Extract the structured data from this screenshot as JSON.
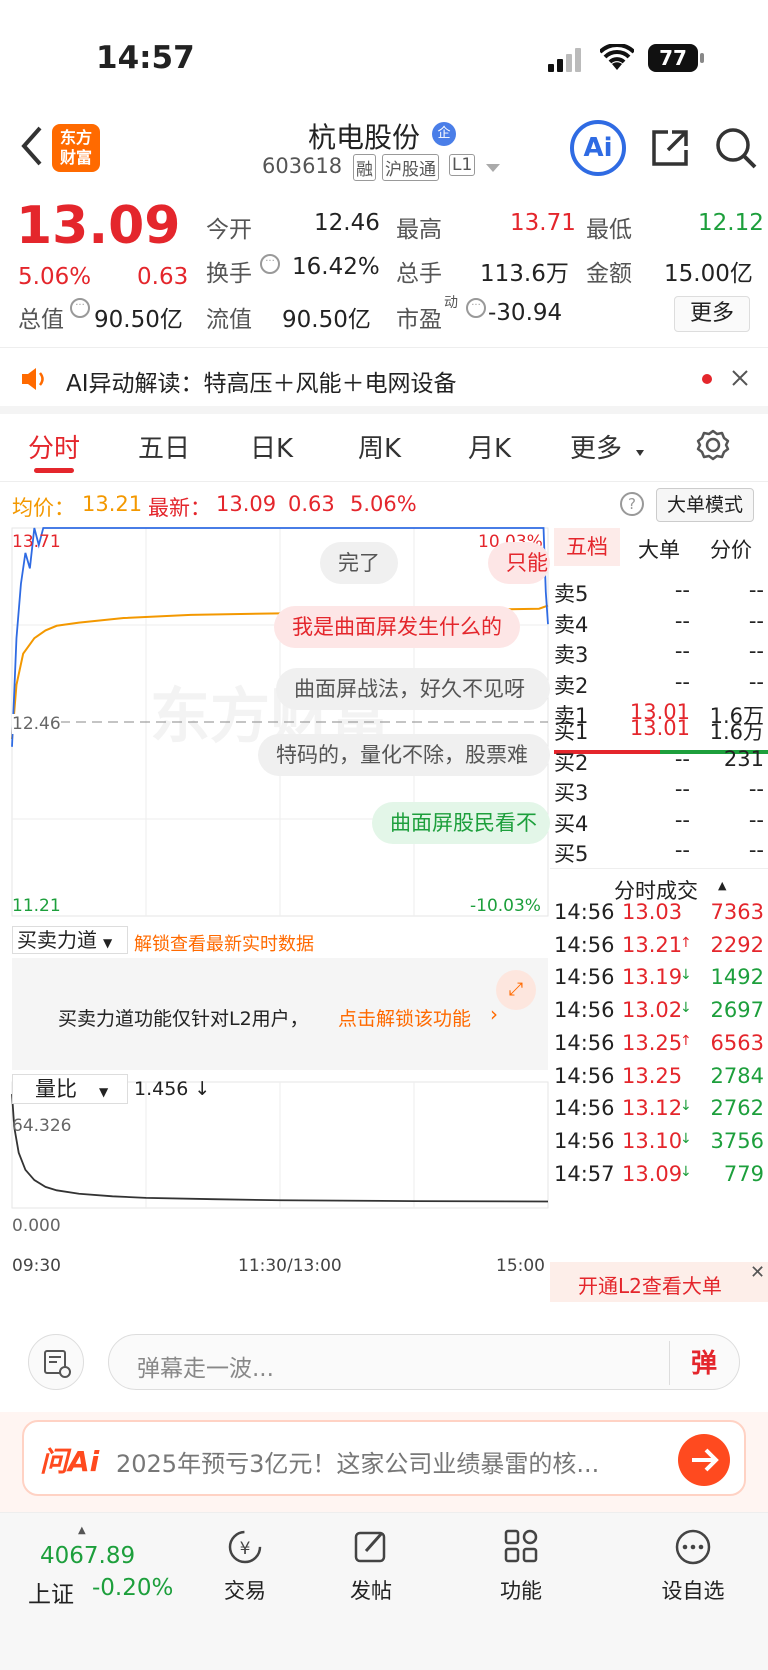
{
  "status": {
    "time": "14:57",
    "battery": "77"
  },
  "header": {
    "name": "杭电股份",
    "badge": "企",
    "code": "603618",
    "tags": [
      "融",
      "沪股通",
      "L1"
    ],
    "ai": "Ai"
  },
  "logo": {
    "line1": "东方",
    "line2": "财富"
  },
  "quote": {
    "price": "13.09",
    "pct": "5.06%",
    "change": "0.63",
    "fields": {
      "open_l": "今开",
      "open_v": "12.46",
      "high_l": "最高",
      "high_v": "13.71",
      "low_l": "最低",
      "low_v": "12.12",
      "turn_l": "换手",
      "turn_v": "16.42%",
      "vol_l": "总手",
      "vol_v": "113.6万",
      "amt_l": "金额",
      "amt_v": "15.00亿",
      "mcap_l": "总值",
      "mcap_v": "90.50亿",
      "float_l": "流值",
      "float_v": "90.50亿",
      "pe_l": "市盈",
      "pe_sup": "动",
      "pe_v": "-30.94"
    },
    "more": "更多"
  },
  "ai_banner": {
    "text": "AI异动解读：特高压＋风能＋电网设备"
  },
  "tabs": [
    "分时",
    "五日",
    "日K",
    "周K",
    "月K",
    "更多"
  ],
  "chart_info": {
    "avg_label": "均价：",
    "avg": "13.21",
    "latest_label": "最新：",
    "latest": "13.09",
    "chg": "0.63",
    "pct": "5.06%",
    "mode": "大单模式"
  },
  "chart_data": {
    "type": "line",
    "title": "",
    "y_max_label": "13.71",
    "y_max_pct": "10.03%",
    "y_mid_label": "12.46",
    "y_min_label": "11.21",
    "y_min_pct": "-10.03%",
    "ylim": [
      11.21,
      13.71
    ],
    "ref": 12.46,
    "price": {
      "x": [
        0,
        2,
        4,
        6,
        8,
        10,
        12,
        14,
        16,
        18,
        20,
        23,
        25,
        27,
        30,
        60,
        120,
        238,
        239,
        240
      ],
      "y": [
        12.3,
        13.0,
        13.35,
        13.55,
        13.45,
        13.71,
        13.6,
        13.71,
        13.71,
        13.71,
        13.71,
        13.71,
        13.71,
        13.71,
        13.71,
        13.71,
        13.71,
        13.71,
        13.3,
        13.09
      ]
    },
    "avg_line": {
      "x": [
        0,
        2,
        5,
        10,
        15,
        20,
        30,
        50,
        80,
        120,
        160,
        200,
        236,
        240
      ],
      "y": [
        12.35,
        12.7,
        12.9,
        13.0,
        13.05,
        13.08,
        13.1,
        13.13,
        13.15,
        13.16,
        13.17,
        13.18,
        13.19,
        13.21
      ]
    },
    "x_labels": [
      "09:30",
      "11:30/13:00",
      "15:00"
    ],
    "ratio": {
      "name": "量比",
      "value": "1.456 ↓",
      "max_label": "64.326",
      "min_label": "0.000",
      "x": [
        0,
        1,
        3,
        6,
        10,
        15,
        20,
        30,
        45,
        60,
        90,
        120,
        180,
        240
      ],
      "y": [
        64.3,
        45,
        30,
        20,
        14,
        10,
        8,
        6,
        4.5,
        3.6,
        2.8,
        2.2,
        1.7,
        1.456
      ]
    }
  },
  "danmaku": [
    "完了",
    "只能",
    "我是曲面屏发生什么的",
    "曲面屏战法，好久不见呀",
    "特码的，量化不除，股票难",
    "曲面屏股民看不"
  ],
  "force": {
    "title": "买卖力道",
    "unlock": "解锁查看最新实时数据",
    "msg": "买卖力道功能仅针对L2用户，",
    "link": "点击解锁该功能"
  },
  "book": {
    "tabs": [
      "五档",
      "大单",
      "分价"
    ],
    "asks": [
      [
        "卖5",
        "--",
        "--"
      ],
      [
        "卖4",
        "--",
        "--"
      ],
      [
        "卖3",
        "--",
        "--"
      ],
      [
        "卖2",
        "--",
        "--"
      ],
      [
        "卖1",
        "13.01",
        "1.6万"
      ]
    ],
    "bids": [
      [
        "买1",
        "13.01",
        "1.6万"
      ],
      [
        "买2",
        "--",
        "231"
      ],
      [
        "买3",
        "--",
        "--"
      ],
      [
        "买4",
        "--",
        "--"
      ],
      [
        "买5",
        "--",
        "--"
      ]
    ],
    "ticks_title": "分时成交",
    "ticks": [
      [
        "14:56",
        "13.03",
        "",
        "7363",
        "r",
        "r"
      ],
      [
        "14:56",
        "13.21",
        "↑",
        "2292",
        "r",
        "r"
      ],
      [
        "14:56",
        "13.19",
        "↓",
        "1492",
        "r",
        "g"
      ],
      [
        "14:56",
        "13.02",
        "↓",
        "2697",
        "r",
        "g"
      ],
      [
        "14:56",
        "13.25",
        "↑",
        "6563",
        "r",
        "r"
      ],
      [
        "14:56",
        "13.25",
        "",
        "2784",
        "r",
        "g"
      ],
      [
        "14:56",
        "13.12",
        "↓",
        "2762",
        "r",
        "g"
      ],
      [
        "14:56",
        "13.10",
        "↓",
        "3756",
        "r",
        "g"
      ],
      [
        "14:57",
        "13.09",
        "↓",
        "779",
        "r",
        "g"
      ]
    ],
    "l2": "开通L2查看大单"
  },
  "comment": {
    "placeholder": "弹幕走一波...",
    "btn": "弹"
  },
  "wenai": {
    "brand": "问Ai",
    "text": "2025年预亏3亿元！这家公司业绩暴雷的核..."
  },
  "tabbar": {
    "index_value": "4067.89",
    "index_name": "上证",
    "index_pct": "-0.20%",
    "items": [
      "交易",
      "发帖",
      "功能",
      "设自选"
    ]
  }
}
